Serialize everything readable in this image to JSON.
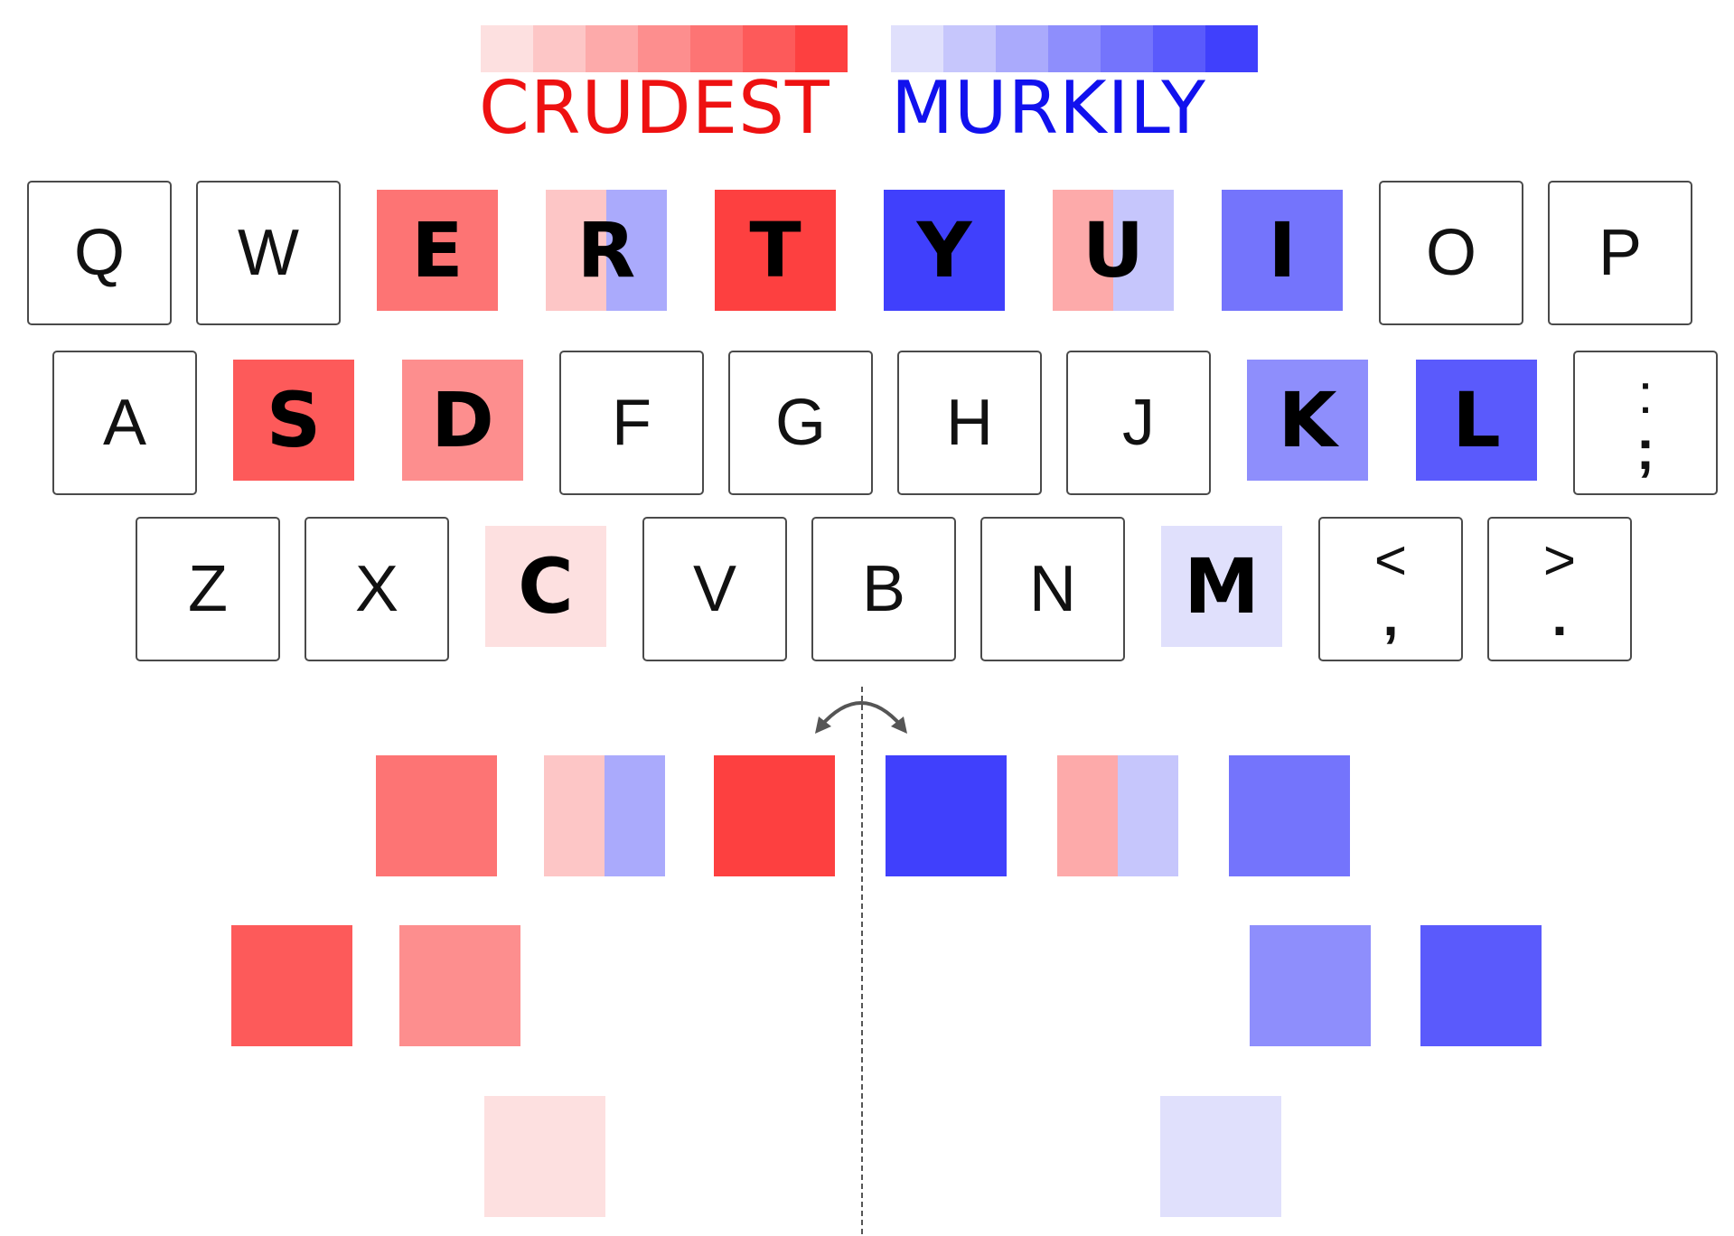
{
  "legend": {
    "left_word": "CRUDEST",
    "right_word": "MURKILY",
    "left_color": "#ee1111",
    "right_color": "#1111ee",
    "red_scale": [
      "#fde0e0",
      "#fdc6c6",
      "#fdaaaa",
      "#fd8e8e",
      "#fd7474",
      "#fd5a5a",
      "#fd4040"
    ],
    "blue_scale": [
      "#e0e0fc",
      "#c6c6fc",
      "#aaaafc",
      "#8e8efc",
      "#7474fc",
      "#5a5afc",
      "#4040fc"
    ]
  },
  "keyboard": {
    "rows": [
      {
        "keys": [
          {
            "label": "Q"
          },
          {
            "label": "W"
          },
          {
            "label": "E",
            "red": "#fd7474"
          },
          {
            "label": "R",
            "red": "#fdc6c6",
            "blue": "#aaaafc"
          },
          {
            "label": "T",
            "red": "#fd4040"
          },
          {
            "label": "Y",
            "blue": "#4040fc"
          },
          {
            "label": "U",
            "red": "#fdaaaa",
            "blue": "#c6c6fc"
          },
          {
            "label": "I",
            "blue": "#7474fc"
          },
          {
            "label": "O"
          },
          {
            "label": "P"
          }
        ]
      },
      {
        "keys": [
          {
            "label": "A"
          },
          {
            "label": "S",
            "red": "#fd5a5a"
          },
          {
            "label": "D",
            "red": "#fd8e8e"
          },
          {
            "label": "F"
          },
          {
            "label": "G"
          },
          {
            "label": "H"
          },
          {
            "label": "J"
          },
          {
            "label": "K",
            "blue": "#8e8efc"
          },
          {
            "label": "L",
            "blue": "#5a5afc"
          },
          {
            "label": ";",
            "upper": ":",
            "lower": ";"
          }
        ]
      },
      {
        "keys": [
          {
            "label": "Z"
          },
          {
            "label": "X"
          },
          {
            "label": "C",
            "red": "#fde0e0"
          },
          {
            "label": "V"
          },
          {
            "label": "B"
          },
          {
            "label": "N"
          },
          {
            "label": "M",
            "blue": "#e0e0fc"
          },
          {
            "label": ",",
            "upper": "<",
            "lower": ","
          },
          {
            "label": ".",
            "upper": ">",
            "lower": "."
          }
        ]
      }
    ]
  },
  "folded": {
    "rows": [
      [
        {
          "red": "#fd7474"
        },
        {
          "red": "#fdc6c6",
          "blue": "#aaaafc"
        },
        {
          "red": "#fd4040"
        },
        {
          "blue": "#4040fc"
        },
        {
          "red": "#fdaaaa",
          "blue": "#c6c6fc"
        },
        {
          "blue": "#7474fc"
        }
      ],
      [
        {
          "red": "#fd5a5a"
        },
        {
          "red": "#fd8e8e"
        },
        {
          "blue": "#8e8efc"
        },
        {
          "blue": "#5a5afc"
        }
      ],
      [
        {
          "red": "#fde0e0"
        },
        {
          "blue": "#e0e0fc"
        }
      ]
    ]
  }
}
